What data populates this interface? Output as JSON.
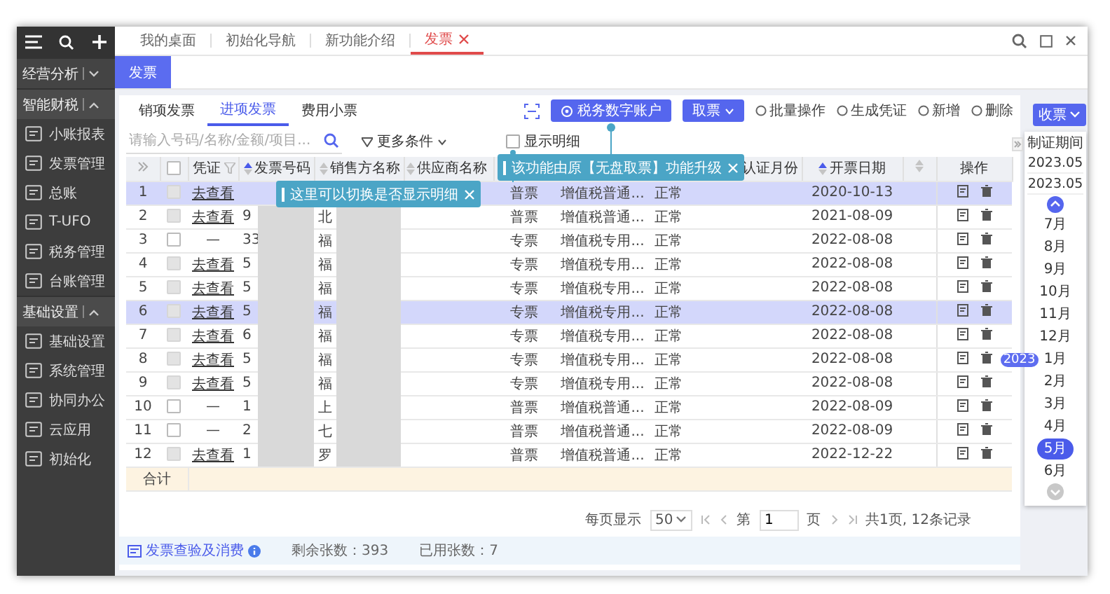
{
  "top_tabs": [
    {
      "label": "我的桌面",
      "selected": false,
      "closable": false
    },
    {
      "label": "初始化导航",
      "selected": false,
      "closable": false
    },
    {
      "label": "新功能介绍",
      "selected": false,
      "closable": false
    },
    {
      "label": "发票",
      "selected": true,
      "closable": true
    }
  ],
  "sub_tabs": [
    {
      "label": "发票",
      "selected": true
    }
  ],
  "sidebar": {
    "groups": [
      {
        "label": "经营分析",
        "expanded": false
      },
      {
        "label": "智能财税",
        "expanded": true,
        "items": [
          "小账报表",
          "发票管理",
          "总账",
          "T-UFO",
          "税务管理",
          "台账管理"
        ]
      },
      {
        "label": "基础设置",
        "expanded": true,
        "items": [
          "基础设置",
          "系统管理",
          "协同办公",
          "云应用",
          "初始化"
        ]
      }
    ]
  },
  "invoice_tabs": [
    {
      "label": "销项发票",
      "selected": false
    },
    {
      "label": "进项发票",
      "selected": true
    },
    {
      "label": "费用小票",
      "selected": false
    }
  ],
  "search": {
    "placeholder": "请输入号码/名称/金额/项目..."
  },
  "more_filters": "更多条件",
  "show_details": {
    "label": "显示明细",
    "checked": false
  },
  "toolbar": [
    {
      "label": "税务数字账户",
      "kind": "primary"
    },
    {
      "label": "取票",
      "kind": "dropdown"
    },
    {
      "label": "批量操作",
      "kind": "text"
    },
    {
      "label": "生成凭证",
      "kind": "text"
    },
    {
      "label": "新增",
      "kind": "text"
    },
    {
      "label": "删除",
      "kind": "text"
    }
  ],
  "table": {
    "columns": [
      {
        "label": "凭证",
        "kind": "filter"
      },
      {
        "label": "发票号码",
        "kind": "sort",
        "active": true
      },
      {
        "label": "销售方名称",
        "kind": "sort",
        "active": false
      },
      {
        "label": "供应商名称",
        "kind": "sort",
        "active": false
      },
      {
        "kind": "plain"
      },
      {
        "kind": "plain"
      },
      {
        "kind": "plain"
      },
      {
        "label": "认证月份",
        "kind": "plain"
      },
      {
        "label": "开票日期",
        "kind": "sort",
        "active": true
      },
      {
        "kind": "sort",
        "active": false
      },
      {
        "label": "操作",
        "kind": "plain"
      }
    ],
    "select_all": false,
    "rows": [
      {
        "no": "1",
        "selected": true,
        "disabled": true,
        "voucher": "去查看",
        "voucher_linked": true,
        "ticket": "普票",
        "category": "增值税普通...",
        "status": "正常",
        "date": "2020-10-13"
      },
      {
        "no": "2",
        "selected": false,
        "disabled": true,
        "voucher": "去查看",
        "voucher_linked": true,
        "invoice_no": "9",
        "seller": "北",
        "ticket": "普票",
        "category": "增值税普通...",
        "status": "正常",
        "date": "2021-08-09"
      },
      {
        "no": "3",
        "selected": false,
        "disabled": false,
        "voucher": "—",
        "voucher_linked": false,
        "invoice_no": "33",
        "seller": "福",
        "ticket": "专票",
        "category": "增值税专用...",
        "status": "正常",
        "date": "2022-08-08"
      },
      {
        "no": "4",
        "selected": false,
        "disabled": true,
        "voucher": "去查看",
        "voucher_linked": true,
        "invoice_no": "5",
        "seller": "福",
        "ticket": "专票",
        "category": "增值税专用...",
        "status": "正常",
        "date": "2022-08-08"
      },
      {
        "no": "5",
        "selected": false,
        "disabled": true,
        "voucher": "去查看",
        "voucher_linked": true,
        "invoice_no": "5",
        "seller": "福",
        "ticket": "专票",
        "category": "增值税专用...",
        "status": "正常",
        "date": "2022-08-08"
      },
      {
        "no": "6",
        "selected": true,
        "disabled": true,
        "voucher": "去查看",
        "voucher_linked": true,
        "invoice_no": "5",
        "seller": "福",
        "ticket": "专票",
        "category": "增值税专用...",
        "status": "正常",
        "date": "2022-08-08"
      },
      {
        "no": "7",
        "selected": false,
        "disabled": true,
        "voucher": "去查看",
        "voucher_linked": true,
        "invoice_no": "6",
        "seller": "福",
        "ticket": "专票",
        "category": "增值税专用...",
        "status": "正常",
        "date": "2022-08-08"
      },
      {
        "no": "8",
        "selected": false,
        "disabled": true,
        "voucher": "去查看",
        "voucher_linked": true,
        "invoice_no": "5",
        "seller": "福",
        "ticket": "专票",
        "category": "增值税专用...",
        "status": "正常",
        "date": "2022-08-08"
      },
      {
        "no": "9",
        "selected": false,
        "disabled": true,
        "voucher": "去查看",
        "voucher_linked": true,
        "invoice_no": "5",
        "seller": "福",
        "ticket": "专票",
        "category": "增值税专用...",
        "status": "正常",
        "date": "2022-08-08"
      },
      {
        "no": "10",
        "selected": false,
        "disabled": false,
        "voucher": "—",
        "voucher_linked": false,
        "invoice_no": "1",
        "seller": "上",
        "ticket": "普票",
        "category": "增值税普通...",
        "status": "正常",
        "date": "2022-08-09"
      },
      {
        "no": "11",
        "selected": false,
        "disabled": false,
        "voucher": "—",
        "voucher_linked": false,
        "invoice_no": "2",
        "seller": "七",
        "ticket": "普票",
        "category": "增值税普通...",
        "status": "正常",
        "date": "2022-08-09"
      },
      {
        "no": "12",
        "selected": false,
        "disabled": true,
        "voucher": "去查看",
        "voucher_linked": true,
        "invoice_no": "1",
        "seller": "罗",
        "ticket": "普票",
        "category": "增值税普通...",
        "status": "正常",
        "date": "2022-12-22"
      }
    ],
    "footer": "合计"
  },
  "tooltips": [
    {
      "text": "这里可以切换是否显示明细"
    },
    {
      "text": "该功能由原【无盘取票】功能升级"
    }
  ],
  "pagination": {
    "page_size_label": "每页显示",
    "page_size": "50",
    "page_label": "第",
    "page": "1",
    "page_suffix": "页",
    "summary": "共1页, 12条记录"
  },
  "bottom_bar": {
    "link": "发票查验及消费",
    "remaining": "剩余张数：393",
    "used": "已用张数：7"
  },
  "period_panel": {
    "button": "收票",
    "title": "制证期间",
    "start": "2023.05",
    "end": "2023.05",
    "months": [
      {
        "label": "7月",
        "selected": false
      },
      {
        "label": "8月",
        "selected": false
      },
      {
        "label": "9月",
        "selected": false
      },
      {
        "label": "10月",
        "selected": false
      },
      {
        "label": "11月",
        "selected": false
      },
      {
        "label": "12月",
        "selected": false
      },
      {
        "label": "1月",
        "selected": false,
        "year": "2023"
      },
      {
        "label": "2月",
        "selected": false
      },
      {
        "label": "3月",
        "selected": false
      },
      {
        "label": "4月",
        "selected": false
      },
      {
        "label": "5月",
        "selected": true
      },
      {
        "label": "6月",
        "selected": false
      }
    ]
  }
}
